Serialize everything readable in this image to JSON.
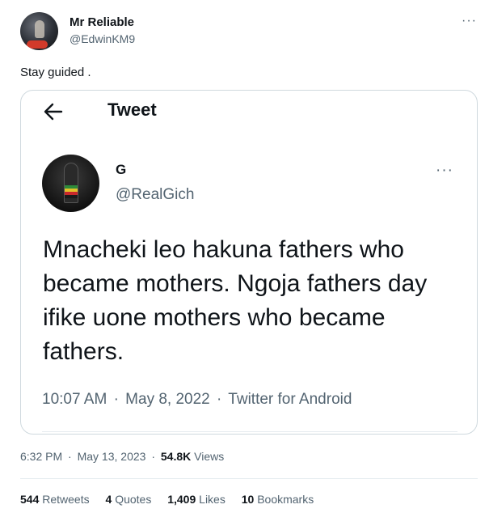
{
  "tweet": {
    "author_name": "Mr Reliable",
    "author_handle": "@EdwinKM9",
    "more_glyph": "···",
    "text": "Stay guided .",
    "time": "6:32 PM",
    "date": "May 13, 2023",
    "views_count": "54.8K",
    "views_label": "Views",
    "dot": "·"
  },
  "quoted_screenshot": {
    "header_title": "Tweet",
    "author_name": "G",
    "author_handle": "@RealGich",
    "more_glyph": "···",
    "body": "Mnacheki leo hakuna fathers who became mothers. Ngoja fathers day ifike uone mothers who became fathers.",
    "time": "10:07 AM",
    "date": "May 8, 2022",
    "source": "Twitter for Android",
    "dot": "·"
  },
  "stats": {
    "retweets": {
      "count": "544",
      "label": "Retweets"
    },
    "quotes": {
      "count": "4",
      "label": "Quotes"
    },
    "likes": {
      "count": "1,409",
      "label": "Likes"
    },
    "bookmarks": {
      "count": "10",
      "label": "Bookmarks"
    }
  },
  "icons": {
    "back": "arrow-left-icon",
    "more": "more-horizontal-icon"
  },
  "colors": {
    "text_primary": "#0f1419",
    "text_secondary": "#536471",
    "border": "#cfd9de"
  }
}
